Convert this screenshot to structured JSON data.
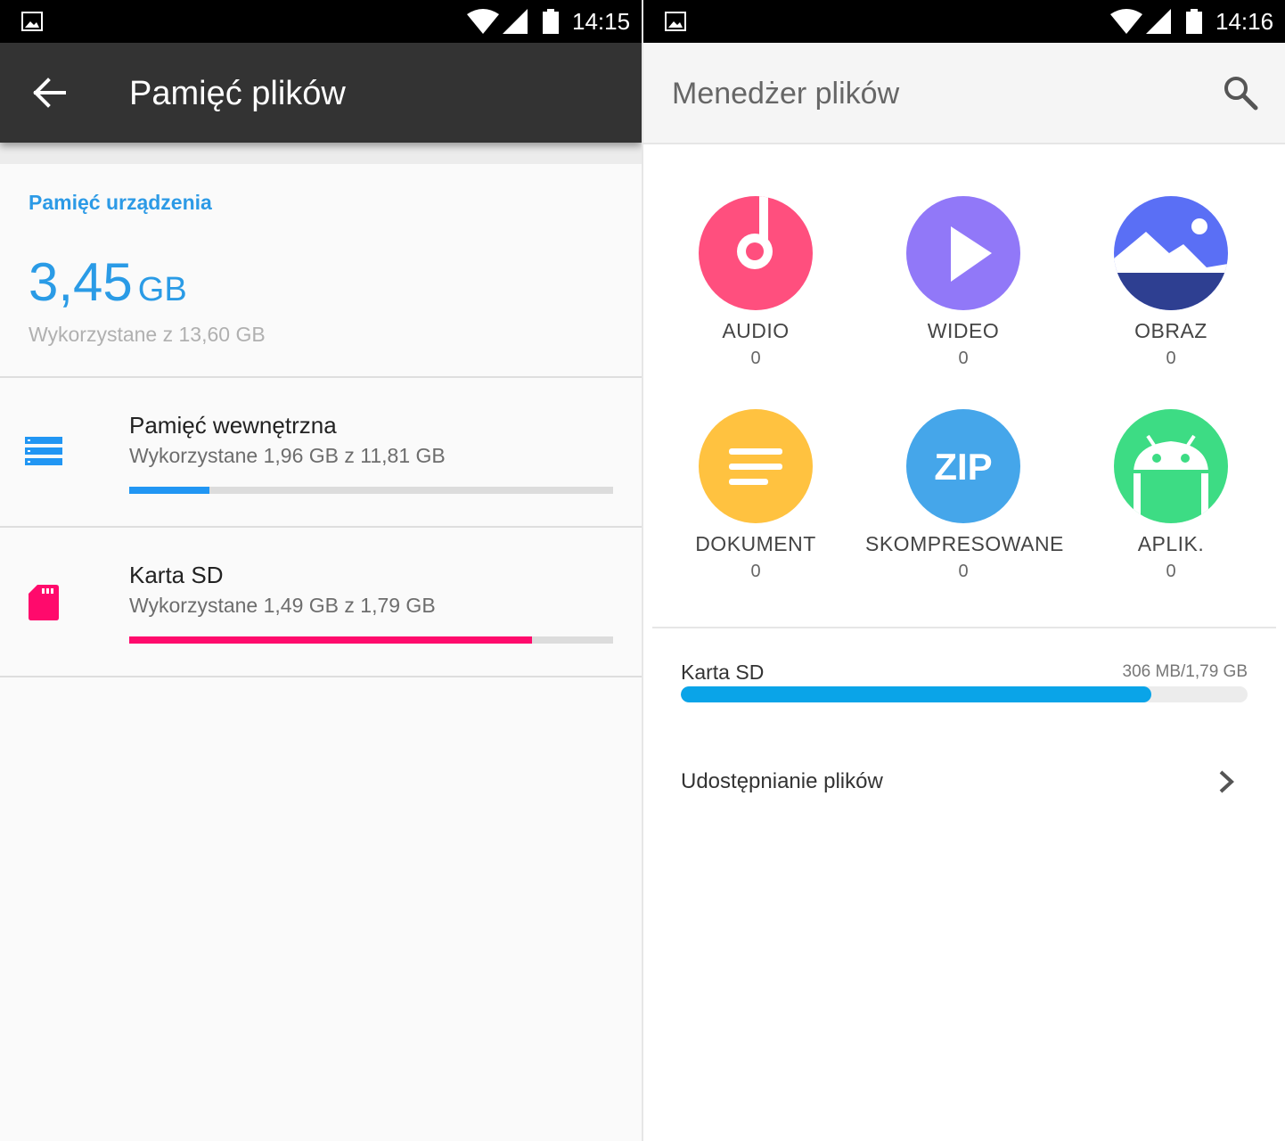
{
  "left": {
    "status": {
      "time": "14:15"
    },
    "appbar": {
      "title": "Pamięć plików"
    },
    "device": {
      "label": "Pamięć urządzenia",
      "used_value": "3,45",
      "used_unit": "GB",
      "subtitle": "Wykorzystane z 13,60 GB"
    },
    "storages": [
      {
        "name": "Pamięć wewnętrzna",
        "used": "Wykorzystane 1,96 GB z 11,81 GB",
        "fraction": 0.166,
        "color": "#2196f3",
        "icon": "storage-icon"
      },
      {
        "name": "Karta SD",
        "used": "Wykorzystane 1,49 GB z 1,79 GB",
        "fraction": 0.832,
        "color": "#ff0a6c",
        "icon": "sd-card-icon"
      }
    ]
  },
  "right": {
    "status": {
      "time": "14:16"
    },
    "appbar": {
      "title": "Menedżer plików"
    },
    "categories": [
      {
        "name": "AUDIO",
        "count": "0",
        "color": "#ff4f7e",
        "icon": "music-note-icon"
      },
      {
        "name": "WIDEO",
        "count": "0",
        "color": "#9178f8",
        "icon": "play-icon"
      },
      {
        "name": "OBRAZ",
        "count": "0",
        "color": "#5a6ff5",
        "icon": "landscape-icon"
      },
      {
        "name": "DOKUMENT",
        "count": "0",
        "color": "#ffc240",
        "icon": "document-icon"
      },
      {
        "name": "SKOMPRESOWANE",
        "count": "0",
        "color": "#45a6ea",
        "icon": "zip-icon",
        "icon_text": "ZIP"
      },
      {
        "name": "APLIK.",
        "count": "0",
        "color": "#3ddc84",
        "icon": "android-icon"
      }
    ],
    "sd": {
      "label": "Karta SD",
      "size": "306 MB/1,79 GB",
      "fraction": 0.83
    },
    "share": {
      "label": "Udostępnianie plików"
    }
  }
}
